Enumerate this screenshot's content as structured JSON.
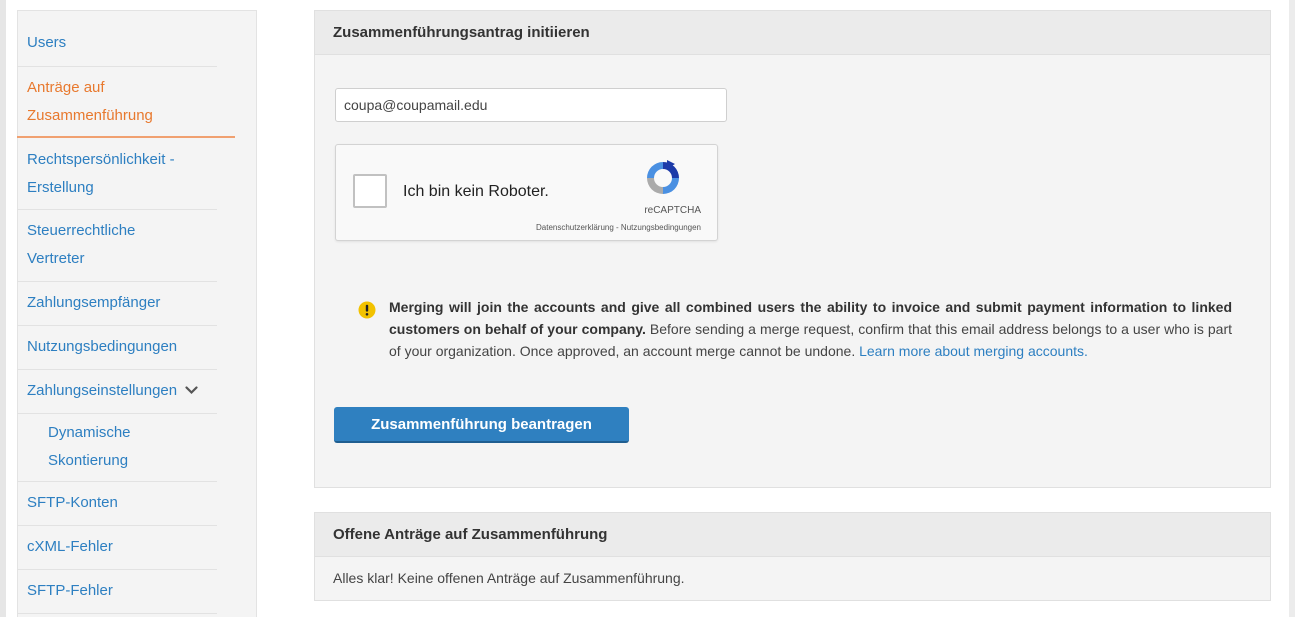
{
  "sidebar": {
    "items": [
      {
        "label": "Users"
      },
      {
        "label_line1": "Anträge auf",
        "label_line2": "Zusammenführung"
      },
      {
        "label_line1": "Rechtspersönlichkeit -",
        "label_line2": "Erstellung"
      },
      {
        "label_line1": "Steuerrechtliche",
        "label_line2": "Vertreter"
      },
      {
        "label": "Zahlungsempfänger"
      },
      {
        "label": "Nutzungsbedingungen"
      },
      {
        "label": "Zahlungseinstellungen"
      },
      {
        "label_line1": "Dynamische",
        "label_line2": "Skontierung"
      },
      {
        "label": "SFTP-Konten"
      },
      {
        "label": "cXML-Fehler"
      },
      {
        "label": "SFTP-Fehler"
      }
    ]
  },
  "merge_panel": {
    "title": "Zusammenführungsantrag initiieren",
    "email_value": "coupa@coupamail.edu",
    "captcha": {
      "label": "Ich bin kein Roboter.",
      "brand": "reCAPTCHA",
      "links": "Datenschutzerklärung - Nutzungsbedingungen"
    },
    "warning": {
      "bold_text": "Merging will join the accounts and give all combined users the ability to invoice and submit payment information to linked customers on behalf of your company.",
      "body_text": " Before sending a merge request, confirm that this email address belongs to a user who is part of your organization. Once approved, an account merge cannot be undone. ",
      "link_text": "Learn more about merging accounts."
    },
    "button_label": "Zusammenführung beantragen"
  },
  "open_requests_panel": {
    "title": "Offene Anträge auf Zusammenführung",
    "message": "Alles klar! Keine offenen Anträge auf Zusammenführung."
  },
  "colors": {
    "link": "#2d7fc1",
    "active": "#e8792e",
    "button": "#2f80c0",
    "warning_icon": "#f2c200"
  }
}
